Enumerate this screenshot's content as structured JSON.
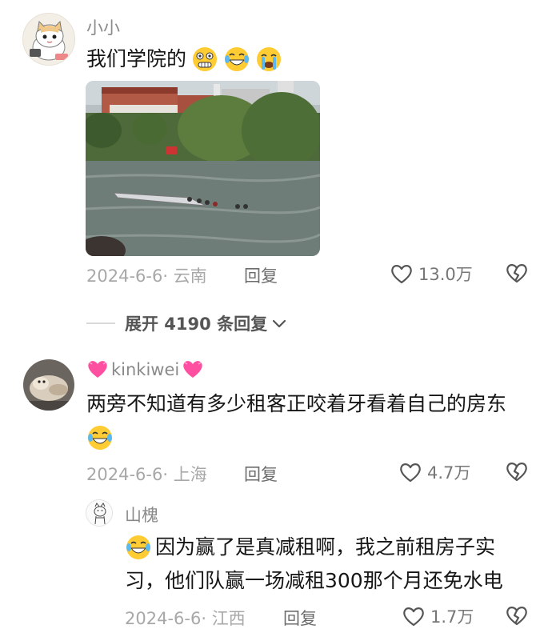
{
  "comments": [
    {
      "username": "小小",
      "text": "我们学院的",
      "emojis": [
        "grimace-emoji",
        "laughing-tears-emoji",
        "crying-emoji"
      ],
      "date": "2024-6-6",
      "location": "云南",
      "reply_label": "回复",
      "likes": "13.0万",
      "expand_label": "展开 4190 条回复"
    },
    {
      "username": "kinkiwei",
      "text": "两旁不知道有多少租客正咬着牙看着自己的房东",
      "emojis": [
        "heart-emoji",
        "laughing-tears-emoji"
      ],
      "date": "2024-6-6",
      "location": "上海",
      "reply_label": "回复",
      "likes": "4.7万"
    },
    {
      "username": "山槐",
      "text_line1": "因为赢了是真减租啊，我之前租房子实",
      "text_line2": "习，他们队赢一场减租300那个月还免水电",
      "emojis": [
        "laughing-tears-emoji"
      ],
      "date": "2024-6-6",
      "location": "江西",
      "reply_label": "回复",
      "likes": "1.7万"
    }
  ],
  "colors": {
    "text": "#161616",
    "meta": "#a8a8a8",
    "username": "#8a8a8a",
    "reply": "#6d6d6d"
  }
}
